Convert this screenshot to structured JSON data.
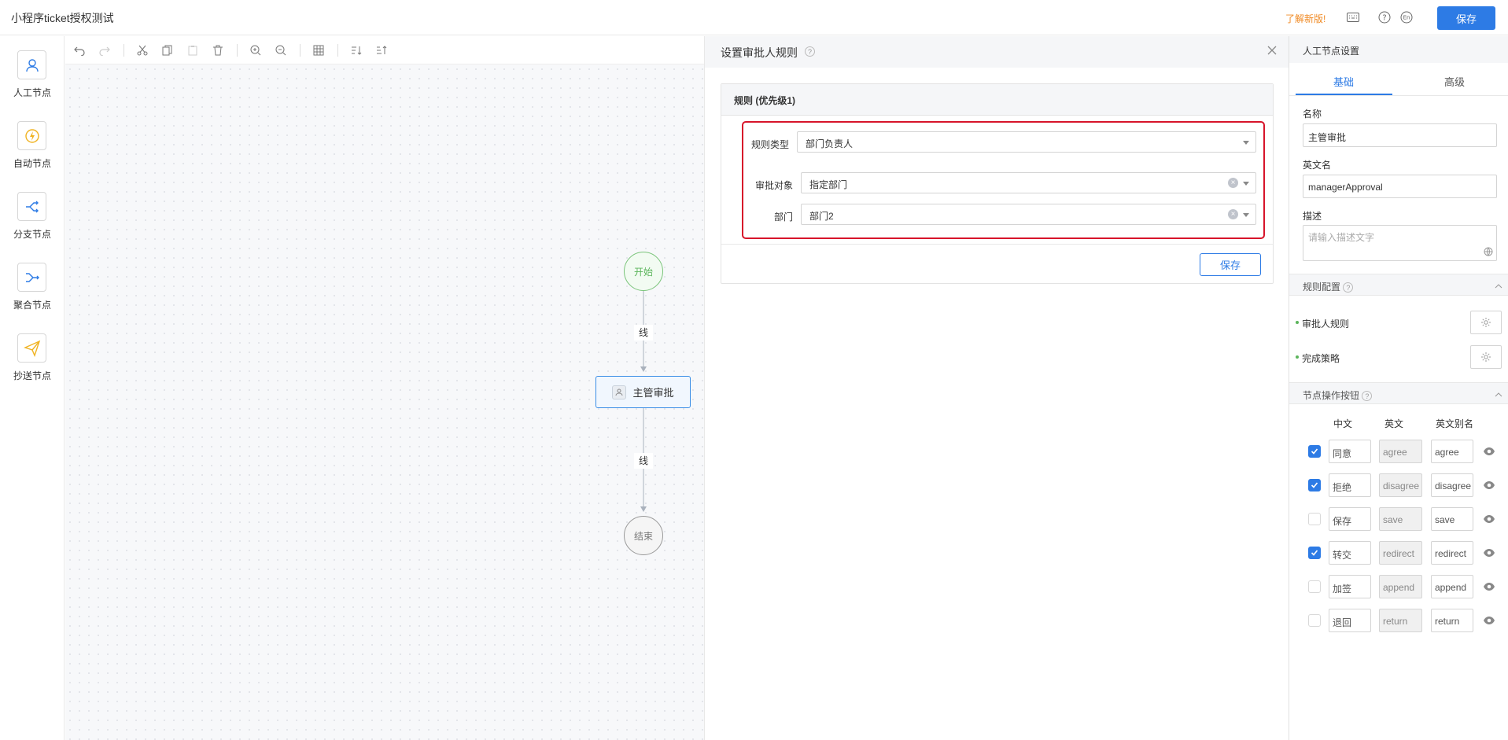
{
  "app": {
    "title": "小程序ticket授权测试",
    "new_version_link": "了解新版!",
    "save_label": "保存"
  },
  "palette": [
    {
      "label": "人工节点",
      "icon": "user-icon"
    },
    {
      "label": "自动节点",
      "icon": "lightning-icon"
    },
    {
      "label": "分支节点",
      "icon": "branch-icon"
    },
    {
      "label": "聚合节点",
      "icon": "merge-icon"
    },
    {
      "label": "抄送节点",
      "icon": "send-icon"
    }
  ],
  "flow": {
    "start": "开始",
    "task": "主管审批",
    "end": "结束",
    "edge1": "线",
    "edge2": "线"
  },
  "dialog": {
    "title": "设置审批人规则",
    "card_title": "规则 (优先级1)",
    "fields": [
      {
        "label": "规则类型",
        "value": "部门负责人"
      },
      {
        "label": "审批对象",
        "value": "指定部门"
      },
      {
        "label": "部门",
        "value": "部门2"
      }
    ],
    "save_label": "保存"
  },
  "props": {
    "title": "人工节点设置",
    "tabs": [
      "基础",
      "高级"
    ],
    "active_tab": "基础",
    "name_label": "名称",
    "name_value": "主管审批",
    "en_label": "英文名",
    "en_value": "managerApproval",
    "desc_label": "描述",
    "desc_placeholder": "请输入描述文字",
    "rule_section": "规则配置",
    "rules": [
      "审批人规则",
      "完成策略"
    ],
    "btn_section": "节点操作按钮",
    "columns": [
      "中文",
      "英文",
      "英文别名"
    ],
    "buttons": [
      {
        "cn": "同意",
        "en": "agree",
        "alias": "agree",
        "checked": true
      },
      {
        "cn": "拒绝",
        "en": "disagree",
        "alias": "disagree",
        "checked": true
      },
      {
        "cn": "保存",
        "en": "save",
        "alias": "save",
        "checked": false
      },
      {
        "cn": "转交",
        "en": "redirect",
        "alias": "redirect",
        "checked": true
      },
      {
        "cn": "加签",
        "en": "append",
        "alias": "append",
        "checked": false
      },
      {
        "cn": "退回",
        "en": "return",
        "alias": "return",
        "checked": false
      }
    ]
  },
  "colors": {
    "primary": "#2d7be5",
    "highlight_border": "#d7142a",
    "new_link": "#f08a24",
    "start_node": "#5bb55b"
  }
}
